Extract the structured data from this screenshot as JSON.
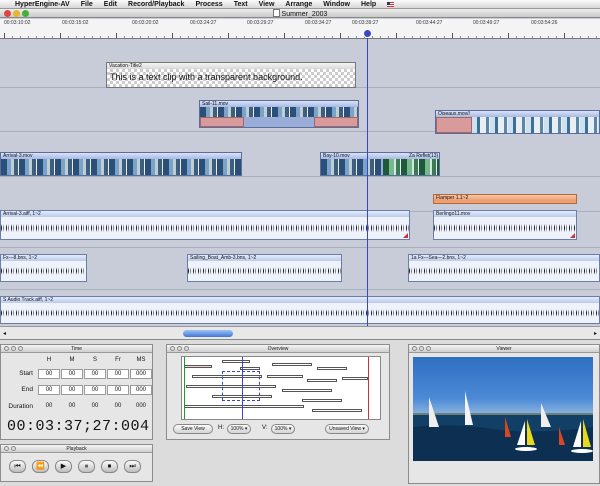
{
  "menubar": {
    "items": [
      "HyperEngine-AV",
      "File",
      "Edit",
      "Record/Playback",
      "Process",
      "Text",
      "View",
      "Arrange",
      "Window",
      "Help"
    ]
  },
  "window": {
    "title": "Summer_2003"
  },
  "ruler": {
    "labels": [
      "00:03:10:02",
      "00:03:15:02",
      "00:03:20:02",
      "00:03:24:27",
      "00:03:29:27",
      "00:03:34:27",
      "00:03:39:27",
      "00:03:44:27",
      "00:03:49:27",
      "00:03:54:26"
    ]
  },
  "clips": {
    "vacation_title": "Vacation-Title2",
    "vacation_text": "This is a text clip with a transparent background.",
    "sail": "Sail-11.mov",
    "oiseaux": "Oiseaux.mov//",
    "arrival": "Arrival-3.mov",
    "bay": "Bay-10.mov",
    "reflet": "Za Reflet(13)",
    "flamper": "Flamper 1.1~2",
    "arrival_aiff": "Arrival-3.aiff, 1~2",
    "berlingo": "Berlingo11.mov",
    "fx": "Fx—8.bns, 1~2",
    "sailing_boat": "Sailing_Boat_Amb-3.bns, 1~2",
    "la_fx": "1a Fx—Sea—2.bns, 1~2",
    "audio_track": "S Audio Track.aiff, 1~2"
  },
  "time_palette": {
    "title": "Time",
    "columns": [
      "H",
      "M",
      "S",
      "Fr",
      "MS"
    ],
    "start_label": "Start",
    "end_label": "End",
    "duration_label": "Duration",
    "start": [
      "00",
      "00",
      "00",
      "00",
      "000"
    ],
    "end": [
      "00",
      "00",
      "00",
      "00",
      "000"
    ],
    "duration": [
      "00",
      "00",
      "00",
      "00",
      "000"
    ],
    "current_time": "00:03:37;27:004"
  },
  "playback_palette": {
    "title": "Playback",
    "buttons": [
      "⏮",
      "⏪",
      "▶",
      "⏸",
      "⏹",
      "⏭"
    ]
  },
  "overview_palette": {
    "title": "Overview",
    "save_view": "Save View",
    "h_label": "H:",
    "h_value": "100%",
    "v_label": "V:",
    "v_value": "100%",
    "unsaved_view": "Unsaved View"
  },
  "viewer_palette": {
    "title": "Viewer"
  },
  "colors": {
    "timeline_bg": "#c7ccd8",
    "playhead": "#3a47c4",
    "clip_header": "#a9b9e2",
    "fade_pink": "#d89a9a",
    "flamper_orange": "#f0a070"
  }
}
